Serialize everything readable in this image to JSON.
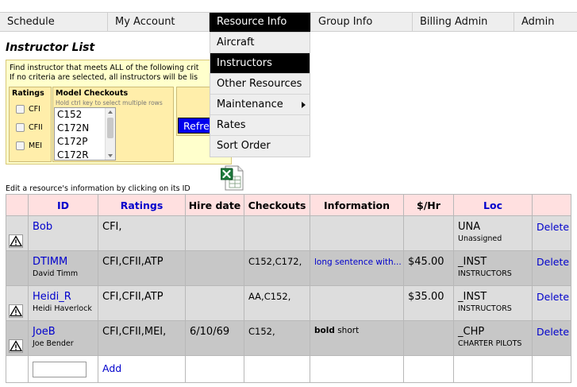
{
  "nav": {
    "items": [
      {
        "label": "Schedule"
      },
      {
        "label": "My Account"
      },
      {
        "label": "Resource Info"
      },
      {
        "label": "Group Info"
      },
      {
        "label": "Billing Admin"
      },
      {
        "label": "Admin"
      }
    ],
    "active": "Resource Info"
  },
  "dropdown": {
    "items": [
      {
        "label": "Aircraft"
      },
      {
        "label": "Instructors"
      },
      {
        "label": "Other Resources"
      },
      {
        "label": "Maintenance"
      },
      {
        "label": "Rates"
      },
      {
        "label": "Sort Order"
      }
    ],
    "active": "Instructors"
  },
  "page": {
    "title": "Instructor List",
    "edit_hint": "Edit a resource's information by clicking on its ID"
  },
  "filter": {
    "line1": "Find instructor that meets ALL of the following crit",
    "line2": "If no criteria are selected, all instructors will be lis",
    "ratings_title": "Ratings",
    "ratings": [
      "CFI",
      "CFII",
      "MEI"
    ],
    "models_title": "Model Checkouts",
    "models_hint": "Hold ctrl key to select multiple rows",
    "models": [
      "C152",
      "C172N",
      "C172P",
      "C172R"
    ],
    "refresh_label": "Refre"
  },
  "table": {
    "headers": {
      "id": "ID",
      "ratings": "Ratings",
      "hire": "Hire date",
      "checkouts": "Checkouts",
      "info": "Information",
      "rate": "$/Hr",
      "loc": "Loc"
    },
    "rows": [
      {
        "warn": true,
        "id": "Bob",
        "name": "",
        "ratings": "CFI,",
        "hire": "",
        "checkouts": "",
        "info_bold": "",
        "info": "",
        "info_link": "",
        "rate": "",
        "loc": "UNA",
        "loc_name": "Unassigned",
        "delete": "Delete"
      },
      {
        "warn": false,
        "id": "DTIMM",
        "name": "David Timm",
        "ratings": "CFI,CFII,ATP",
        "hire": "",
        "checkouts": "C152,C172,",
        "info_bold": "",
        "info": "",
        "info_link": "long sentence with...",
        "rate": "$45.00",
        "loc": "_INST",
        "loc_name": "INSTRUCTORS",
        "delete": "Delete"
      },
      {
        "warn": true,
        "id": "Heidi_R",
        "name": "Heidi Haverlock",
        "ratings": "CFI,CFII,ATP",
        "hire": "",
        "checkouts": "AA,C152,",
        "info_bold": "",
        "info": "",
        "info_link": "",
        "rate": "$35.00",
        "loc": "_INST",
        "loc_name": "INSTRUCTORS",
        "delete": "Delete"
      },
      {
        "warn": true,
        "id": "JoeB",
        "name": "Joe Bender",
        "ratings": "CFI,CFII,MEI,",
        "hire": "6/10/69",
        "checkouts": "C152,",
        "info_bold": "bold",
        "info": " short",
        "info_link": "",
        "rate": "",
        "loc": "_CHP",
        "loc_name": "CHARTER PILOTS",
        "delete": "Delete"
      }
    ],
    "add_label": "Add",
    "new_id_value": ""
  }
}
